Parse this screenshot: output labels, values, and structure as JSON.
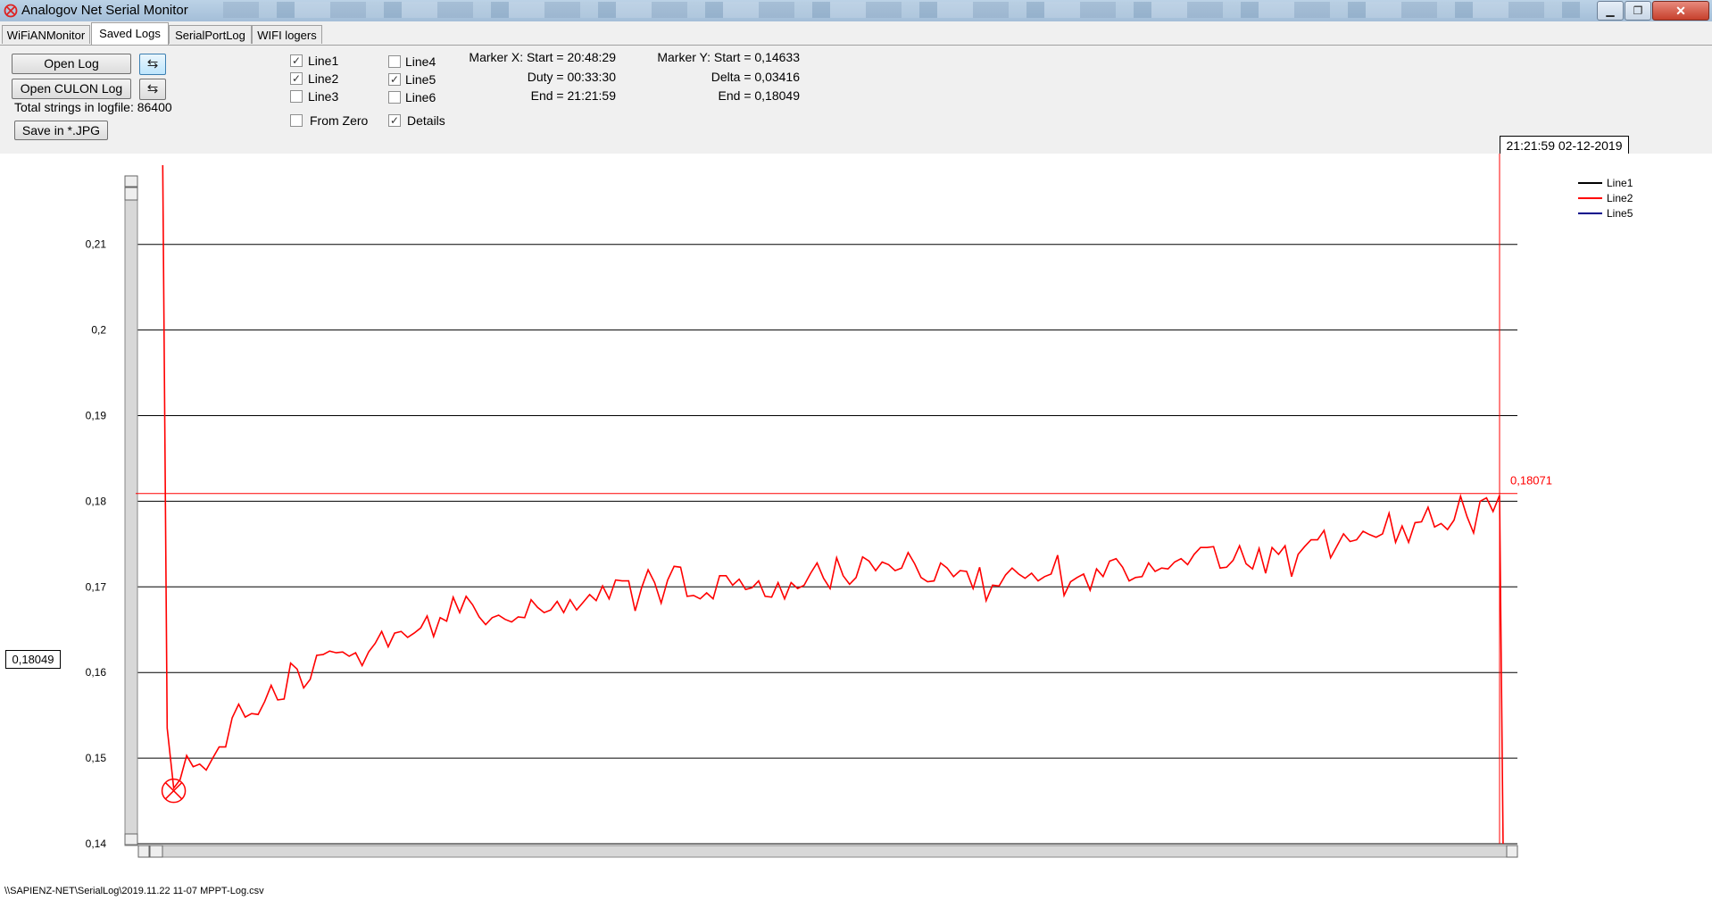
{
  "window": {
    "title": "Analogov Net Serial Monitor"
  },
  "tabs": [
    {
      "label": "WiFiANMonitor"
    },
    {
      "label": "Saved Logs"
    },
    {
      "label": "SerialPortLog"
    },
    {
      "label": "WIFI logers"
    }
  ],
  "controls": {
    "open_log": "Open Log",
    "open_culon_log": "Open CULON Log",
    "total_strings": "Total strings in logfile: 86400",
    "save_jpg": "Save in *.JPG",
    "checkboxes": [
      {
        "label": "Line1",
        "checked": true
      },
      {
        "label": "Line2",
        "checked": true
      },
      {
        "label": "Line3",
        "checked": false
      },
      {
        "label": "Line4",
        "checked": false
      },
      {
        "label": "Line5",
        "checked": true
      },
      {
        "label": "Line6",
        "checked": false
      },
      {
        "label": "From Zero",
        "checked": false
      },
      {
        "label": "Details",
        "checked": true
      }
    ]
  },
  "markers": {
    "x_start": "Marker X: Start = 20:48:29",
    "x_duty": "Duty = 00:33:30",
    "x_end": "End  = 21:21:59",
    "y_start": "Marker Y: Start = 0,14633",
    "y_delta": "Delta = 0,03416",
    "y_end": "End  = 0,18049"
  },
  "datetime": "21:21:59 02-12-2019",
  "y_marker_value": "0,18049",
  "status_path": "\\\\SAPIENZ-NET\\SerialLog\\2019.11.22 11-07 MPPT-Log.csv",
  "chart_data": {
    "type": "line",
    "ylim": [
      0.14,
      0.218
    ],
    "yticks": [
      "0,21",
      "0,2",
      "0,19",
      "0,18",
      "0,17",
      "0,16",
      "0,15",
      "0,14"
    ],
    "ytick_values": [
      0.21,
      0.2,
      0.19,
      0.18,
      0.17,
      0.16,
      0.15,
      0.14
    ],
    "grid": true,
    "legend": [
      {
        "name": "Line1",
        "color": "#000000"
      },
      {
        "name": "Line2",
        "color": "#ff0000"
      },
      {
        "name": "Line5",
        "color": "#00008b"
      }
    ],
    "series": [
      {
        "name": "Line2",
        "color": "#ff0000",
        "values": [
          0.25,
          0.1535,
          0.1465,
          0.1475,
          0.1503,
          0.149,
          0.1493,
          0.1486,
          0.15,
          0.1513,
          0.1513,
          0.1547,
          0.1563,
          0.1548,
          0.1552,
          0.1551,
          0.1566,
          0.1585,
          0.1568,
          0.1569,
          0.1611,
          0.1604,
          0.1582,
          0.1592,
          0.162,
          0.1621,
          0.1625,
          0.1623,
          0.1624,
          0.1619,
          0.1623,
          0.1608,
          0.1624,
          0.1634,
          0.1648,
          0.163,
          0.1646,
          0.1648,
          0.1641,
          0.1646,
          0.1652,
          0.1666,
          0.1642,
          0.1664,
          0.166,
          0.1688,
          0.167,
          0.1689,
          0.1679,
          0.1665,
          0.1656,
          0.1664,
          0.1667,
          0.1662,
          0.1659,
          0.1665,
          0.1664,
          0.1685,
          0.1676,
          0.167,
          0.1673,
          0.1683,
          0.167,
          0.1685,
          0.1673,
          0.1682,
          0.1691,
          0.1684,
          0.1701,
          0.1686,
          0.1708,
          0.1707,
          0.1707,
          0.1672,
          0.1699,
          0.172,
          0.1705,
          0.1681,
          0.1708,
          0.1724,
          0.1723,
          0.1689,
          0.169,
          0.1686,
          0.1693,
          0.1686,
          0.1713,
          0.1713,
          0.1702,
          0.1709,
          0.1697,
          0.1699,
          0.1707,
          0.1689,
          0.1688,
          0.1705,
          0.1686,
          0.1705,
          0.1698,
          0.1702,
          0.1716,
          0.1728,
          0.171,
          0.1698,
          0.1734,
          0.1713,
          0.1703,
          0.1711,
          0.1735,
          0.173,
          0.1719,
          0.1729,
          0.1726,
          0.1719,
          0.1722,
          0.174,
          0.1727,
          0.1711,
          0.1706,
          0.1707,
          0.1728,
          0.1722,
          0.1712,
          0.1719,
          0.1718,
          0.1698,
          0.1723,
          0.1684,
          0.1702,
          0.1701,
          0.1714,
          0.1722,
          0.1715,
          0.171,
          0.1716,
          0.1707,
          0.1712,
          0.1715,
          0.1737,
          0.169,
          0.1706,
          0.1711,
          0.1715,
          0.1696,
          0.1721,
          0.1712,
          0.173,
          0.1733,
          0.1723,
          0.1707,
          0.1711,
          0.1712,
          0.1728,
          0.1718,
          0.1722,
          0.1721,
          0.1729,
          0.1733,
          0.1726,
          0.1738,
          0.1746,
          0.1746,
          0.1747,
          0.1722,
          0.1723,
          0.1731,
          0.1748,
          0.1727,
          0.1721,
          0.1745,
          0.1716,
          0.1746,
          0.1738,
          0.1748,
          0.1712,
          0.1738,
          0.1747,
          0.1755,
          0.1755,
          0.1766,
          0.1734,
          0.1748,
          0.1762,
          0.1753,
          0.1755,
          0.1765,
          0.1761,
          0.1758,
          0.1762,
          0.1786,
          0.1752,
          0.1771,
          0.1752,
          0.1775,
          0.1776,
          0.1793,
          0.177,
          0.1774,
          0.1767,
          0.1778,
          0.1806,
          0.1782,
          0.1763,
          0.18,
          0.1804,
          0.1788,
          0.1807,
          0.134
        ]
      }
    ],
    "marker_label": "0,18071",
    "marker_y_value": 0.18049,
    "marker_x_index": 2
  }
}
